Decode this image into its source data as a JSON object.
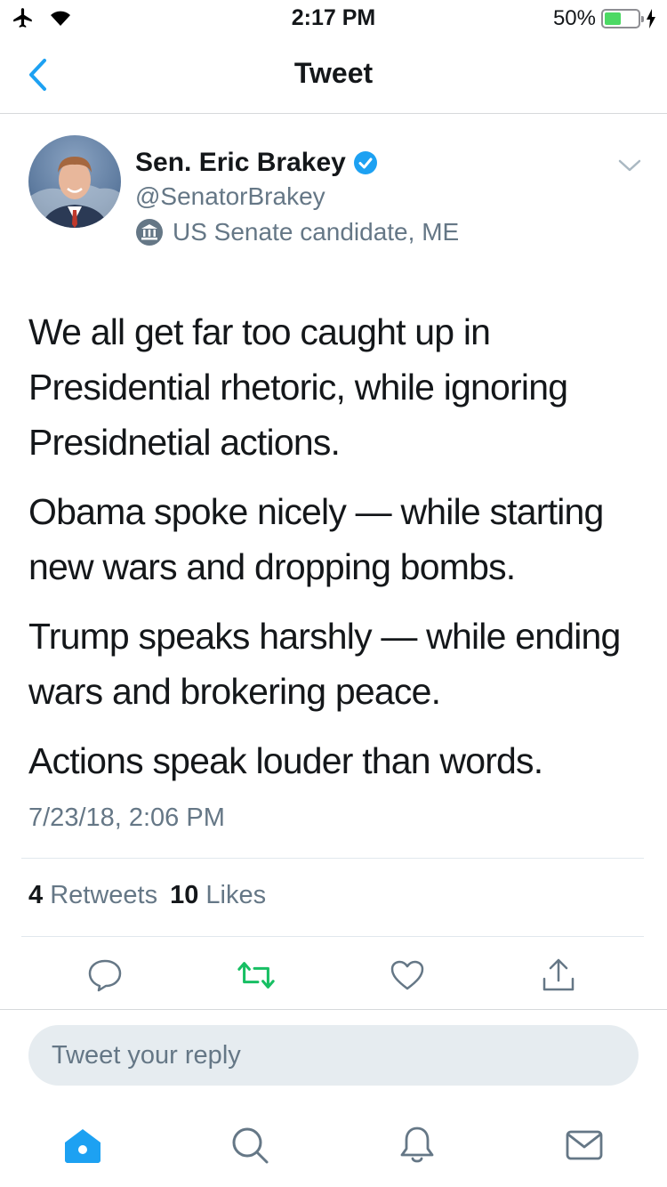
{
  "status_bar": {
    "time": "2:17 PM",
    "battery_percent": "50%",
    "battery_level": 0.5
  },
  "nav": {
    "title": "Tweet"
  },
  "author": {
    "name": "Sen. Eric Brakey",
    "handle": "@SenatorBrakey",
    "label": "US Senate candidate, ME",
    "verified": true
  },
  "tweet": {
    "paragraphs": [
      "We all get far too caught up in Presidential rhetoric, while ignoring Presidnetial actions.",
      "Obama spoke nicely — while starting new wars and dropping bombs.",
      "Trump speaks harshly — while ending wars and brokering peace.",
      "Actions speak louder than words."
    ],
    "timestamp": "7/23/18, 2:06 PM"
  },
  "stats": {
    "retweets_count": "4",
    "retweets_label": "Retweets",
    "likes_count": "10",
    "likes_label": "Likes"
  },
  "actions": [
    "reply-icon",
    "retweet-icon",
    "like-icon",
    "share-icon"
  ],
  "reply_box": {
    "placeholder": "Tweet your reply"
  },
  "tabs": [
    "home-icon",
    "search-icon",
    "notifications-icon",
    "messages-icon"
  ],
  "colors": {
    "accent": "#1da1f2",
    "retweet_green": "#17bf63",
    "icon_gray": "#657786",
    "battery_green": "#4cd964"
  }
}
